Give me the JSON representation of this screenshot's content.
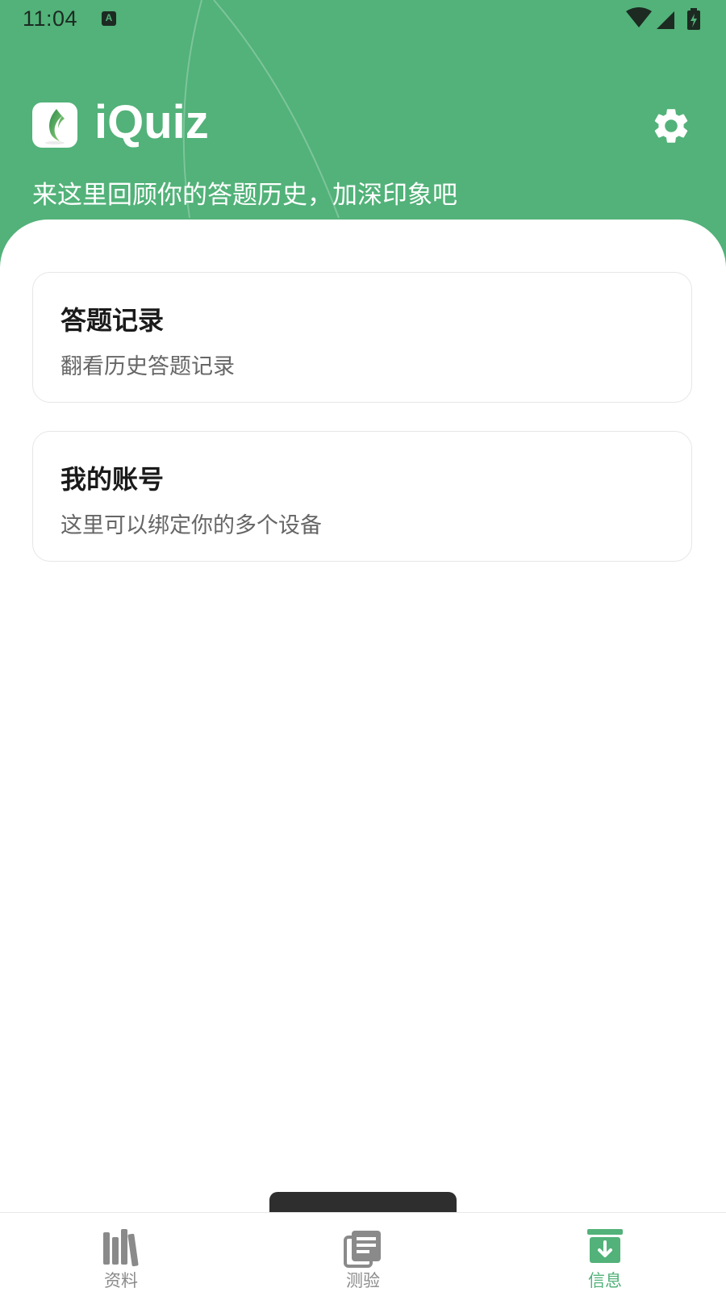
{
  "status_bar": {
    "time": "11:04",
    "notification_icon": "a-notification-icon",
    "right_icons": [
      "wifi-icon",
      "signal-icon",
      "battery-charging-icon"
    ]
  },
  "header": {
    "app_name": "iQuiz",
    "logo_icon": "leaf-logo-icon",
    "settings_icon": "gear-icon",
    "subtitle": "来这里回顾你的答题历史，加深印象吧"
  },
  "cards": [
    {
      "title": "答题记录",
      "description": "翻看历史答题记录"
    },
    {
      "title": "我的账号",
      "description": "这里可以绑定你的多个设备"
    }
  ],
  "bottom_nav": {
    "items": [
      {
        "label": "资料",
        "icon": "library-books-icon",
        "active": false
      },
      {
        "label": "测验",
        "icon": "article-stack-icon",
        "active": false
      },
      {
        "label": "信息",
        "icon": "archive-download-icon",
        "active": true
      }
    ]
  },
  "colors": {
    "brand": "#52b279",
    "card_border": "#e6e6e6",
    "inactive_nav": "#8a8a8a",
    "toast": "#2e2e2e"
  }
}
